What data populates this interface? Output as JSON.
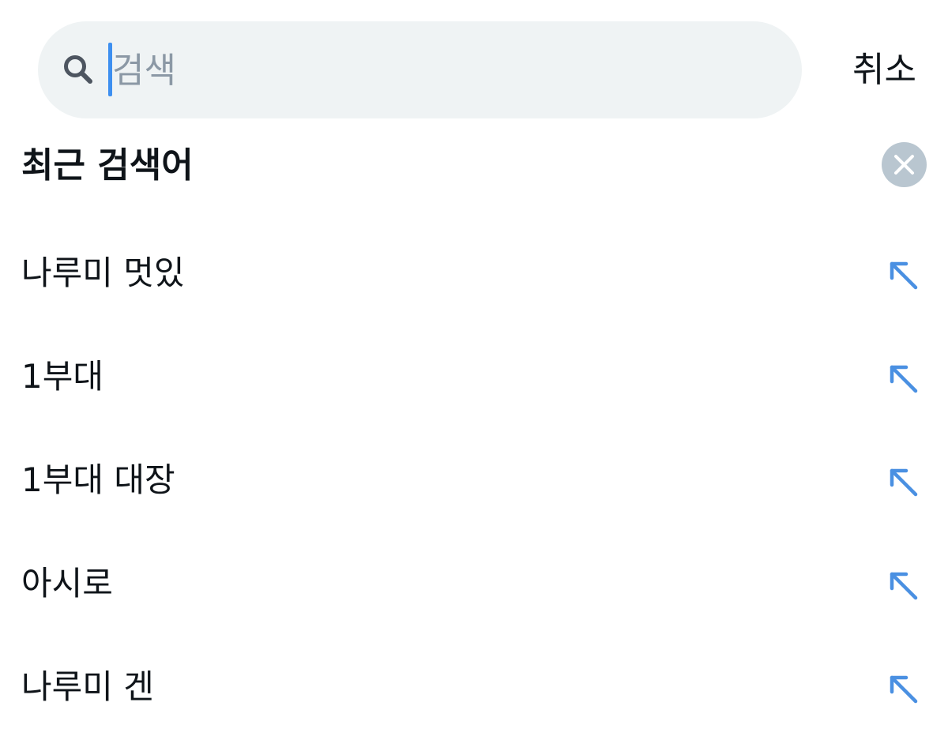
{
  "search": {
    "placeholder": "검색",
    "value": ""
  },
  "cancel_label": "취소",
  "recent": {
    "title": "최근 검색어",
    "items": [
      {
        "label": "나루미 멋있"
      },
      {
        "label": "1부대"
      },
      {
        "label": "1부대 대장"
      },
      {
        "label": "아시로"
      },
      {
        "label": "나루미 겐"
      }
    ]
  },
  "icons": {
    "search": "search-icon",
    "clear": "close-icon",
    "fill_query": "arrow-up-left-icon"
  },
  "colors": {
    "search_background": "#eff3f4",
    "placeholder": "#8b98a5",
    "caret": "#3d8ff0",
    "arrow": "#4a90e2",
    "clear_button": "#b9c6d0",
    "text": "#0f1419"
  }
}
